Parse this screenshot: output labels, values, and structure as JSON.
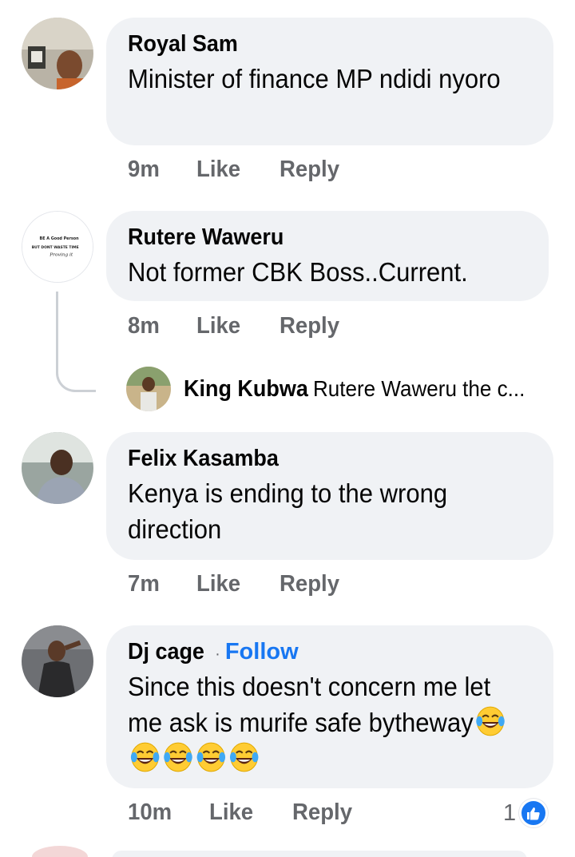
{
  "comments": [
    {
      "author": "Royal Sam",
      "text": "Minister of finance MP ndidi nyoro",
      "time": "9m",
      "like_label": "Like",
      "reply_label": "Reply"
    },
    {
      "author": "Rutere Waweru",
      "text": "Not former CBK Boss..Current.",
      "time": "8m",
      "like_label": "Like",
      "reply_label": "Reply",
      "avatar_text": [
        "BE A Good Person",
        "BUT DONT WASTE TIME",
        "Proving it"
      ]
    },
    {
      "author": "Felix Kasamba",
      "text": "Kenya is ending to the wrong direction",
      "time": "7m",
      "like_label": "Like",
      "reply_label": "Reply"
    },
    {
      "author": "Dj cage",
      "follow_label": "Follow",
      "separator": "·",
      "text": "Since this doesn't concern me let me ask is murife safe bytheway",
      "emoji_name": "laughing-crying-emoji",
      "emoji_count": 5,
      "time": "10m",
      "like_label": "Like",
      "reply_label": "Reply",
      "reaction_count": "1",
      "reaction_icon": "thumbs-up-icon"
    }
  ],
  "reply_preview": {
    "author": "King Kubwa",
    "text": "Rutere Waweru the c..."
  },
  "colors": {
    "bubble": "#f0f2f5",
    "muted": "#65676b",
    "link": "#1877f2",
    "text": "#050505"
  }
}
